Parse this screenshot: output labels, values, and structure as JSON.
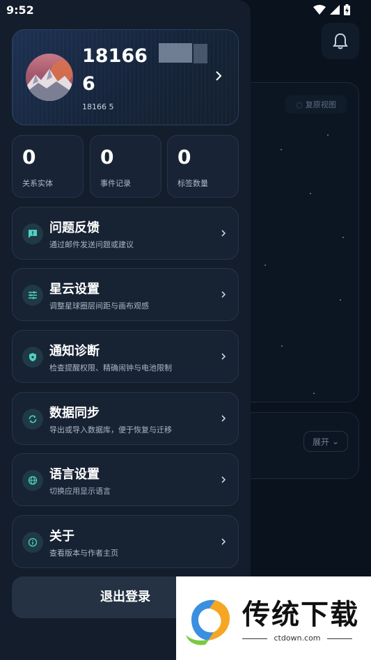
{
  "status_bar": {
    "time": "9:52"
  },
  "background": {
    "reset_view_label": "复原视图",
    "expand_label": "展开"
  },
  "profile": {
    "name": "18166",
    "name_line2": "6",
    "sub": "18166        5"
  },
  "stats": [
    {
      "value": "0",
      "label": "关系实体"
    },
    {
      "value": "0",
      "label": "事件记录"
    },
    {
      "value": "0",
      "label": "标签数量"
    }
  ],
  "menu": [
    {
      "icon": "feedback-icon",
      "title": "问题反馈",
      "desc": "通过邮件发送问题或建议"
    },
    {
      "icon": "tune-icon",
      "title": "星云设置",
      "desc": "调整星球圈层间距与画布观感"
    },
    {
      "icon": "shield-icon",
      "title": "通知诊断",
      "desc": "检查提醒权限、精确闹钟与电池限制"
    },
    {
      "icon": "sync-icon",
      "title": "数据同步",
      "desc": "导出或导入数据库，便于恢复与迁移"
    },
    {
      "icon": "globe-icon",
      "title": "语言设置",
      "desc": "切换应用显示语言"
    },
    {
      "icon": "info-icon",
      "title": "关于",
      "desc": "查看版本与作者主页"
    }
  ],
  "logout_label": "退出登录",
  "watermark": {
    "title": "传统下载",
    "site": "ctdown.com"
  },
  "colors": {
    "accent": "#4fd1c5",
    "icon_bg": "#1f3a44"
  }
}
